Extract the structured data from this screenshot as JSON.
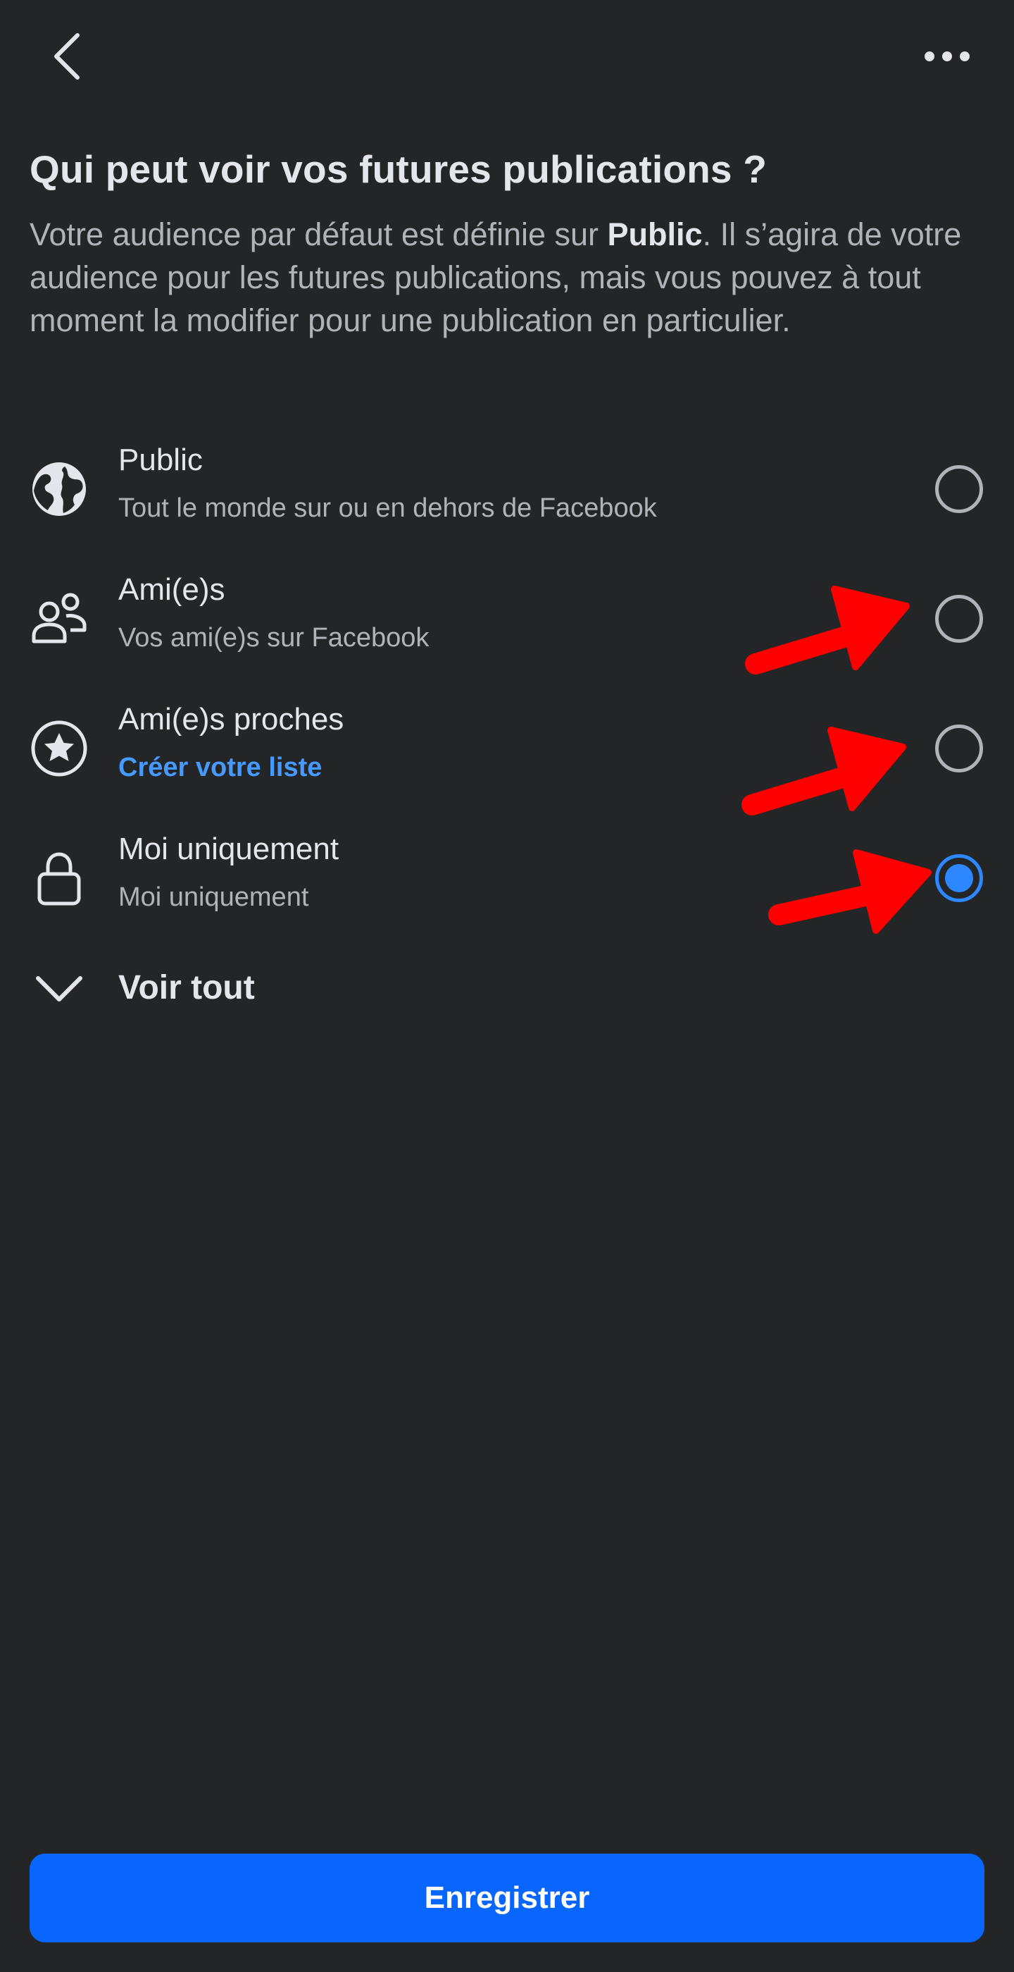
{
  "header": {
    "title": "Qui peut voir vos futures publications ?",
    "description_prefix": "Votre audience par défaut est définie sur ",
    "description_bold": "Public",
    "description_suffix": ". Il s’agira de votre audience pour les futures publications, mais vous pouvez à tout moment la modifier pour une publication en particulier."
  },
  "options": [
    {
      "title": "Public",
      "subtitle": "Tout le monde sur ou en dehors de Facebook",
      "icon": "globe-icon",
      "selected": false
    },
    {
      "title": "Ami(e)s",
      "subtitle": "Vos ami(e)s sur Facebook",
      "icon": "friends-icon",
      "selected": false
    },
    {
      "title": "Ami(e)s proches",
      "subtitle": "Créer votre liste",
      "icon": "star-icon",
      "selected": false,
      "subtitle_is_link": true
    },
    {
      "title": "Moi uniquement",
      "subtitle": "Moi uniquement",
      "icon": "lock-icon",
      "selected": true
    }
  ],
  "see_all_label": "Voir tout",
  "save_label": "Enregistrer",
  "colors": {
    "background": "#242527",
    "primary_text": "#e4e6eb",
    "secondary_text": "#b0b3b8",
    "link": "#4599ff",
    "accent": "#0866ff",
    "annotation_arrow": "#ff0000"
  }
}
